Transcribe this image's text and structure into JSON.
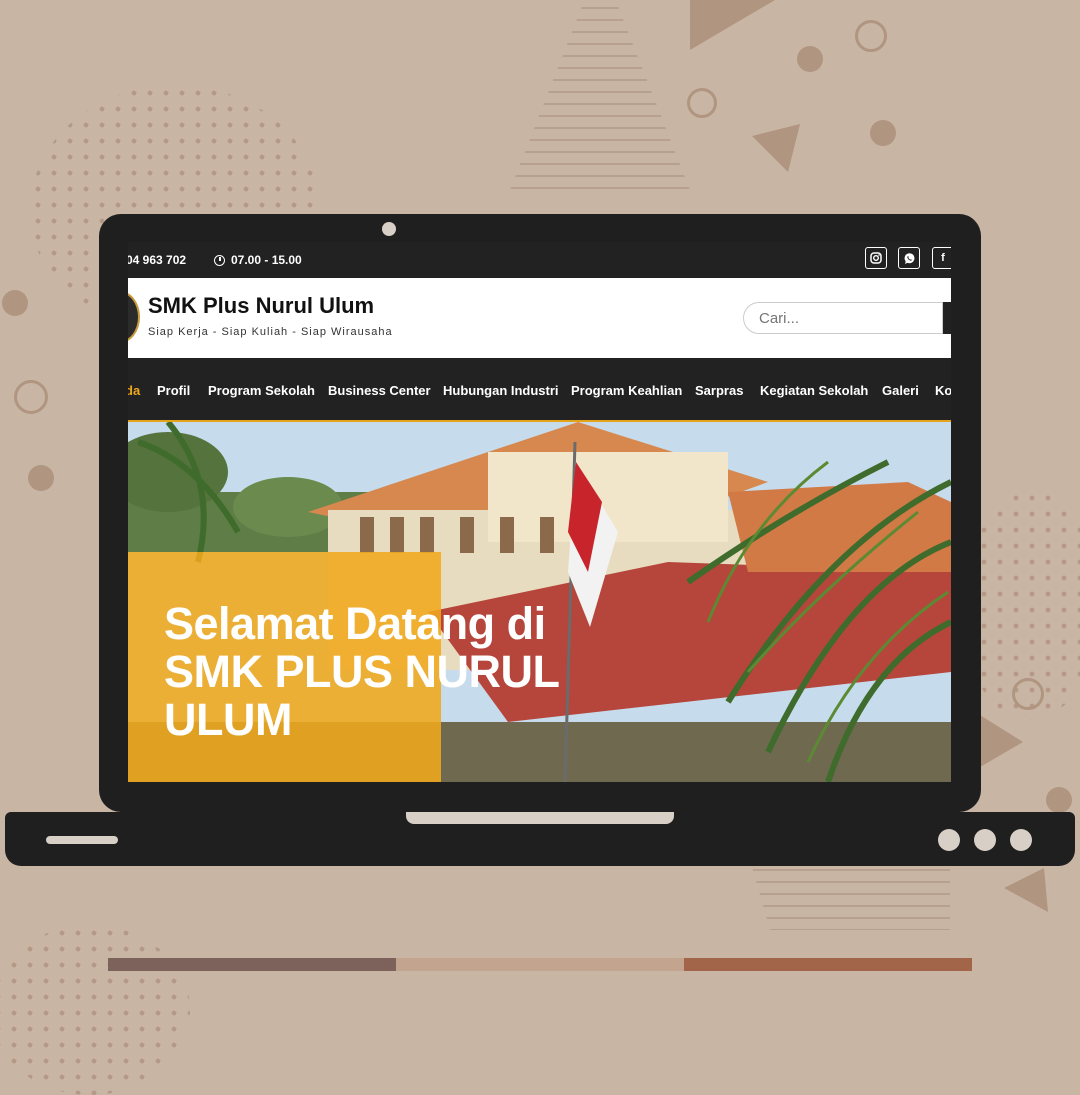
{
  "topbar": {
    "phone": "04 963 702",
    "hours": "07.00 - 15.00",
    "social_icons": [
      "instagram-icon",
      "whatsapp-icon",
      "facebook-icon"
    ],
    "facebook_glyph": "f"
  },
  "header": {
    "site_title": "SMK Plus Nurul Ulum",
    "tagline": "Siap Kerja - Siap Kuliah - Siap Wirausaha",
    "search_placeholder": "Cari..."
  },
  "nav": {
    "items": [
      "da",
      "Profil",
      "Program Sekolah",
      "Business Center",
      "Hubungan Industri",
      "Program Keahlian",
      "Sarpras",
      "Kegiatan Sekolah",
      "Galeri",
      "Ko"
    ],
    "active_index": 0
  },
  "hero": {
    "line1": "Selamat Datang di",
    "line2": "SMK PLUS NURUL",
    "line3": "ULUM"
  },
  "colors": {
    "accent": "#e5a21b",
    "background": "#c9b5a4",
    "laptop": "#1f1f1f",
    "bar_segments": [
      "#7c625a",
      "#c2a48f",
      "#a2654a"
    ]
  }
}
